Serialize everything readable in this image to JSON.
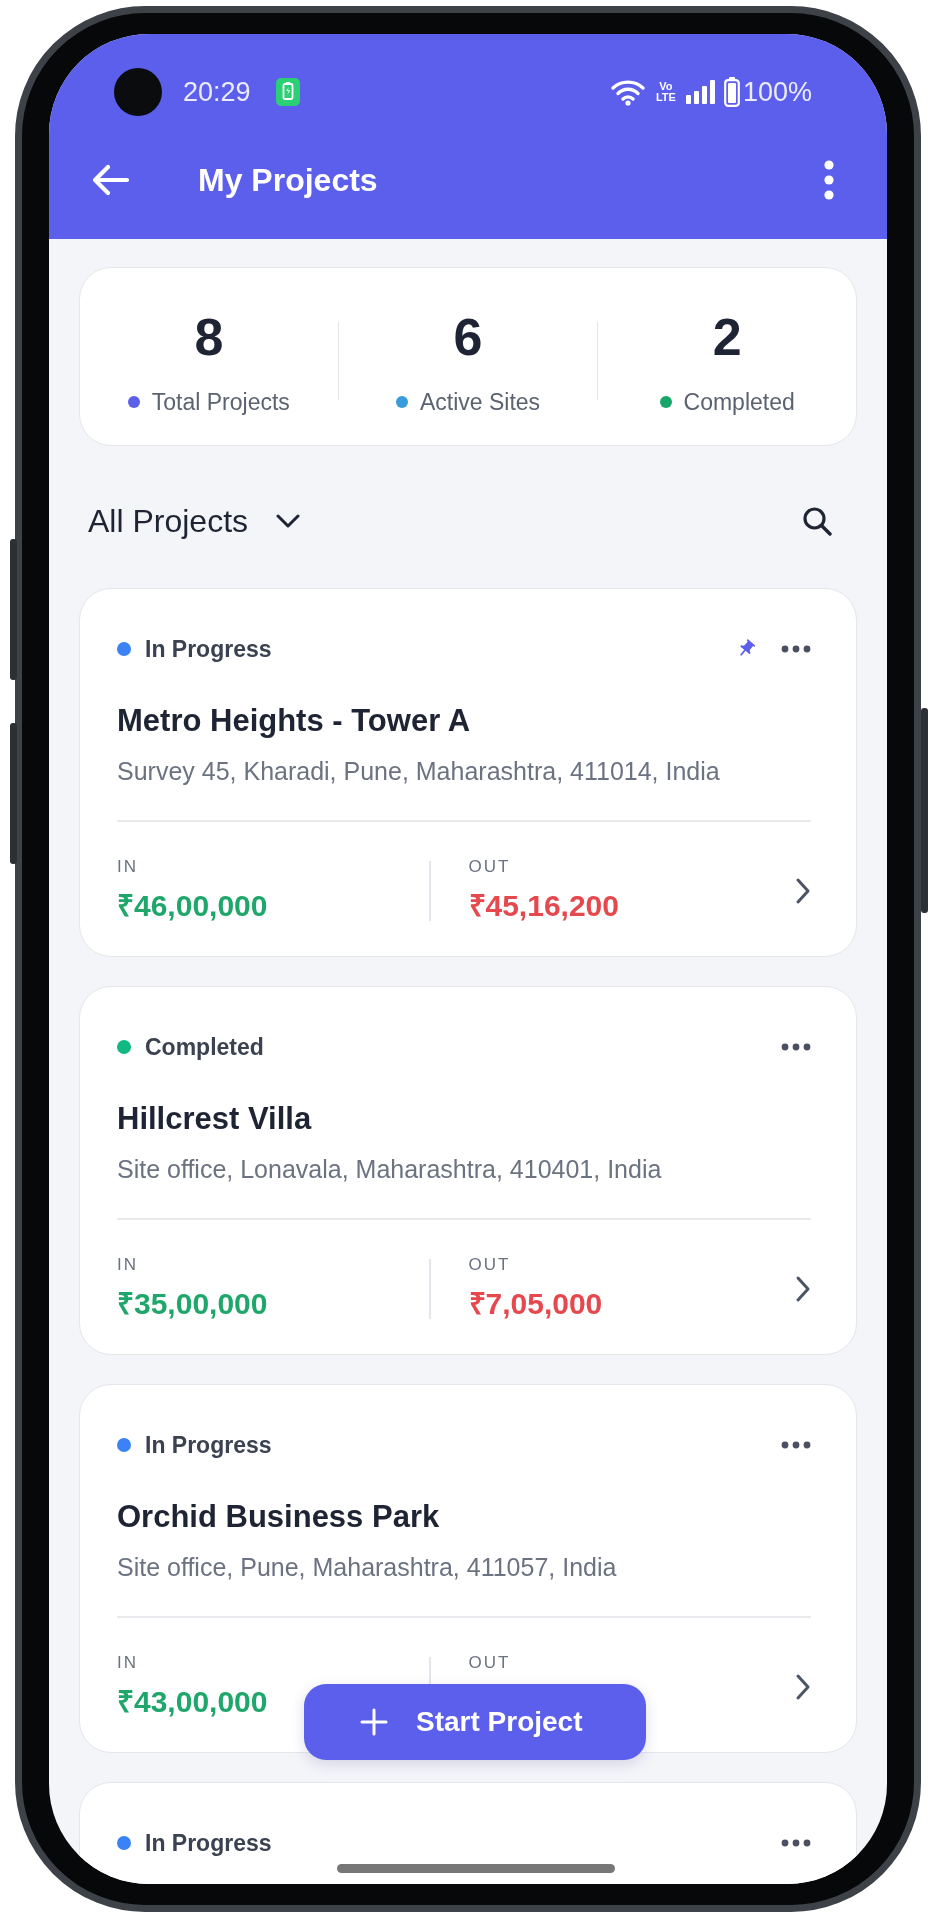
{
  "status_bar": {
    "time": "20:29",
    "network": [
      "Vo",
      "LTE"
    ],
    "battery": "100%"
  },
  "app_bar": {
    "title": "My Projects"
  },
  "summary": [
    {
      "value": "8",
      "label": "Total Projects",
      "color": "#5b5fe9"
    },
    {
      "value": "6",
      "label": "Active Sites",
      "color": "#3a9bdc"
    },
    {
      "value": "2",
      "label": "Completed",
      "color": "#1aa56a"
    }
  ],
  "filter": {
    "label": "All Projects"
  },
  "projects": [
    {
      "status": "In Progress",
      "color": "#3b82f6",
      "pinned": true,
      "name": "Metro Heights - Tower A",
      "address": "Survey 45, Kharadi, Pune, Maharashtra, 411014, India",
      "in_label": "IN",
      "in_amount": "₹46,00,000",
      "out_label": "OUT",
      "out_amount": "₹45,16,200"
    },
    {
      "status": "Completed",
      "color": "#10b981",
      "pinned": false,
      "name": "Hillcrest Villa",
      "address": "Site office, Lonavala, Maharashtra, 410401, India",
      "in_label": "IN",
      "in_amount": "₹35,00,000",
      "out_label": "OUT",
      "out_amount": "₹7,05,000"
    },
    {
      "status": "In Progress",
      "color": "#3b82f6",
      "pinned": false,
      "name": "Orchid Business Park",
      "address": "Site office, Pune, Maharashtra, 411057, India",
      "in_label": "IN",
      "in_amount": "₹43,00,000",
      "out_label": "OUT"
    },
    {
      "status": "In Progress",
      "color": "#3b82f6",
      "pinned": false
    }
  ],
  "fab": {
    "label": "Start Project"
  }
}
